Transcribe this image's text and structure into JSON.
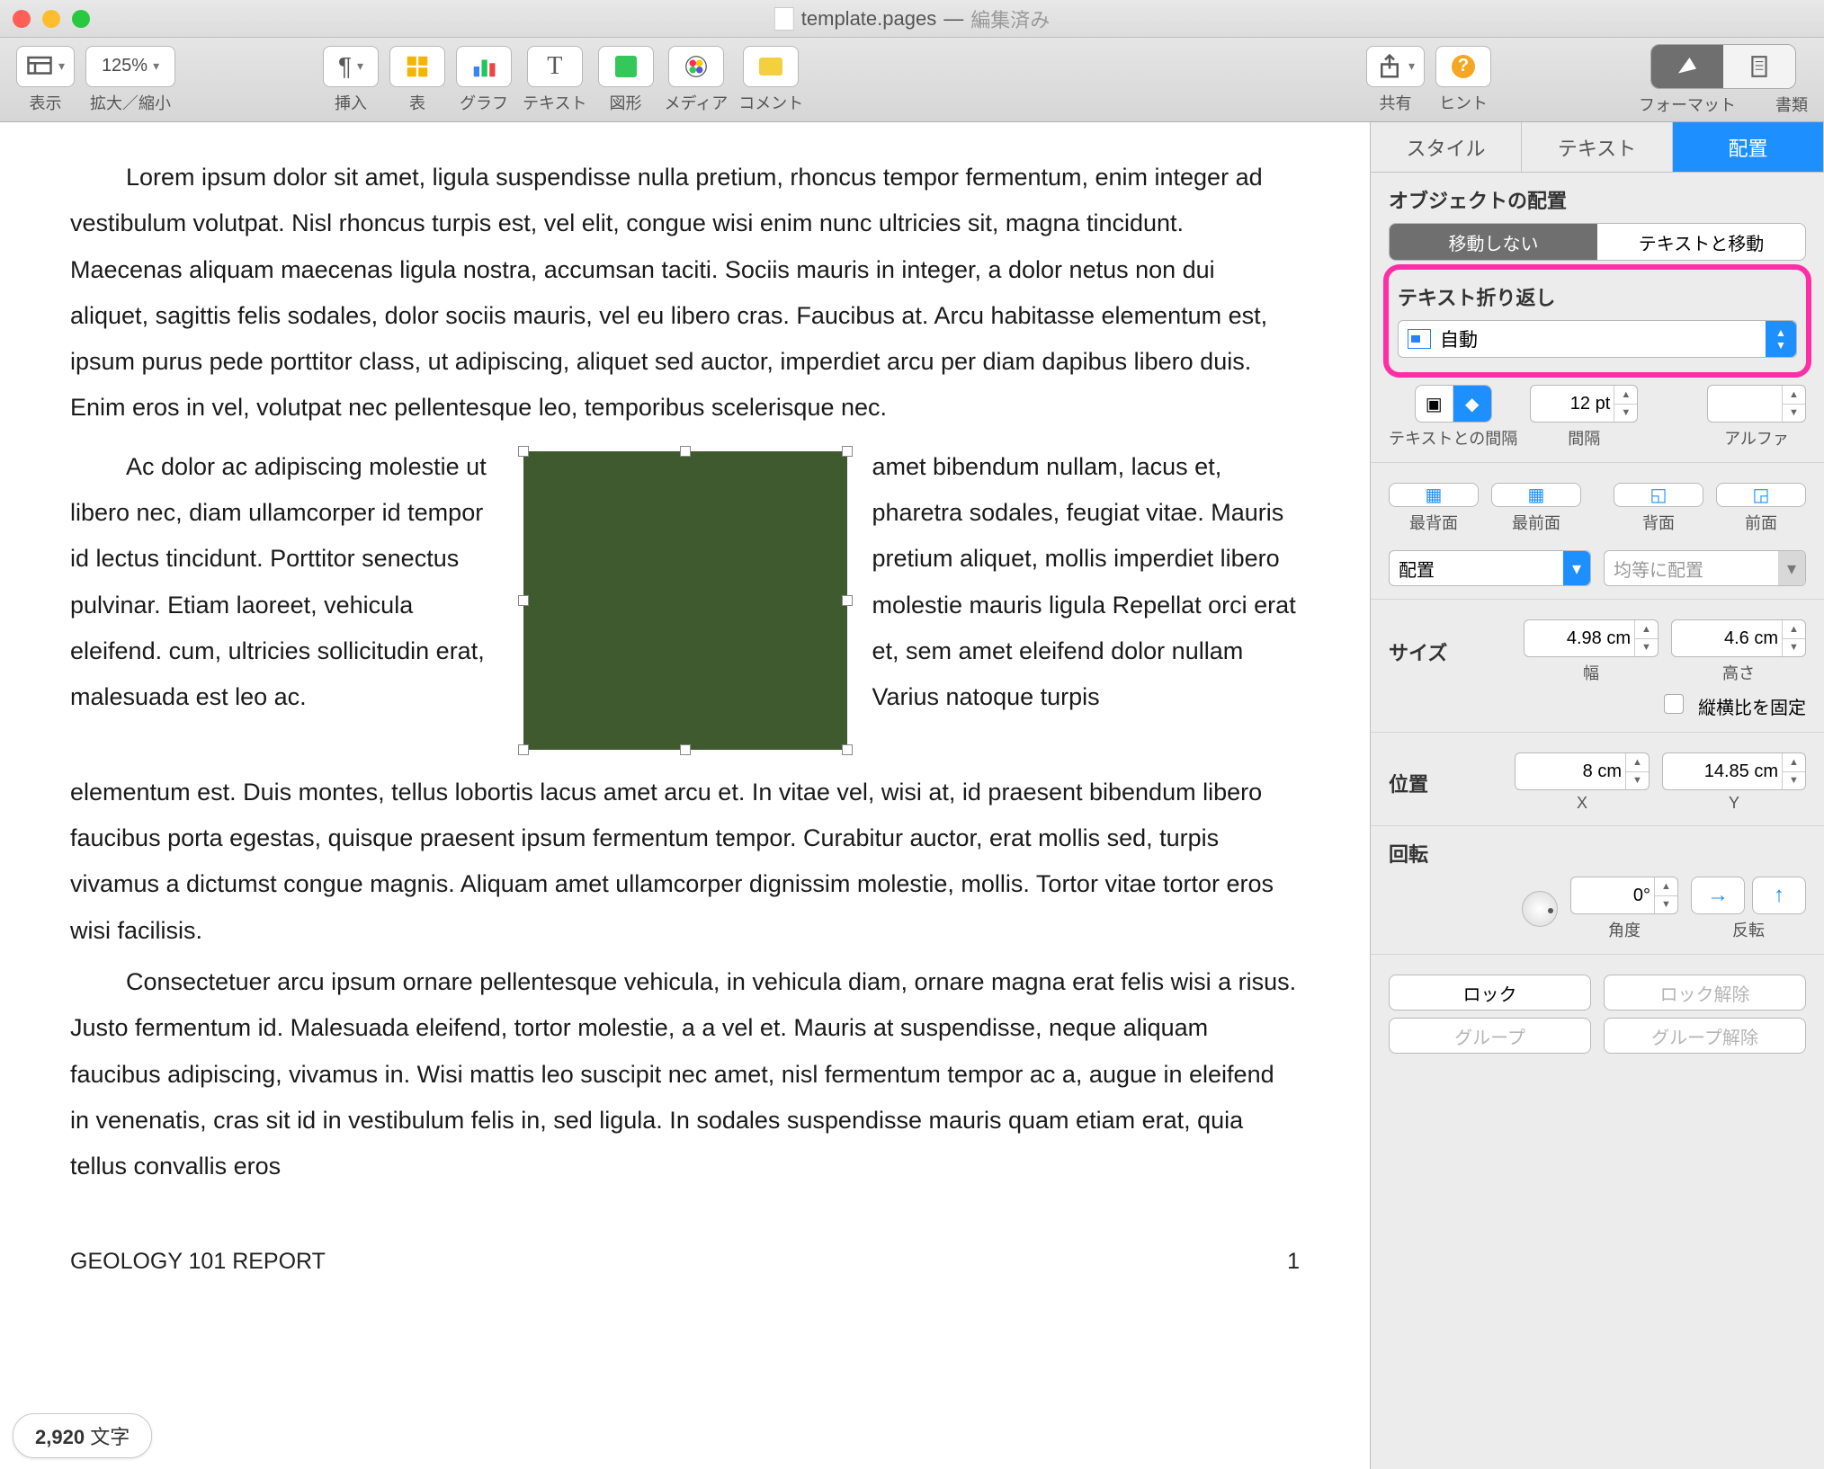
{
  "window": {
    "filename": "template.pages",
    "edited": "編集済み"
  },
  "toolbar": {
    "view": "表示",
    "zoom_value": "125%",
    "zoom_label": "拡大／縮小",
    "insert": "挿入",
    "table": "表",
    "chart": "グラフ",
    "text": "テキスト",
    "shape": "図形",
    "media": "メディア",
    "comment": "コメント",
    "share": "共有",
    "hint": "ヒント",
    "format": "フォーマット",
    "document": "書類"
  },
  "doc": {
    "para1": "Lorem ipsum dolor sit amet, ligula suspendisse nulla pretium, rhoncus tempor fermentum, enim integer ad vestibulum volutpat. Nisl rhoncus turpis est, vel elit, congue wisi enim nunc ultricies sit, magna tincidunt. Maecenas aliquam maecenas ligula nostra, accumsan taciti. Sociis mauris in integer, a dolor netus non dui aliquet, sagittis felis sodales, dolor sociis mauris, vel eu libero cras. Faucibus at. Arcu habitasse elementum est, ipsum purus pede porttitor class, ut adipiscing, aliquet sed auctor, imperdiet arcu per diam dapibus libero duis. Enim eros in vel, volutpat nec pellentesque leo, temporibus scelerisque nec.",
    "wrap_left": "Ac dolor ac adipiscing molestie ut libero nec, diam ullamcorper id tempor id lectus tincidunt. Porttitor senectus pulvinar. Etiam laoreet, vehicula eleifend. cum, ultricies sollicitudin erat, malesuada est leo ac.",
    "wrap_right": "amet bibendum nullam, lacus et, pharetra sodales, feugiat vitae. Mauris pretium aliquet, mollis imperdiet libero molestie mauris ligula Repellat orci erat et, sem amet eleifend dolor nullam Varius natoque turpis",
    "para2": "elementum est. Duis montes, tellus lobortis lacus amet arcu et. In vitae vel, wisi at, id praesent bibendum libero faucibus porta egestas, quisque praesent ipsum fermentum tempor. Curabitur auctor, erat mollis sed, turpis vivamus a dictumst congue magnis. Aliquam amet ullamcorper dignissim molestie, mollis. Tortor vitae tortor eros wisi facilisis.",
    "para3": "Consectetuer arcu ipsum ornare pellentesque vehicula, in vehicula diam, ornare magna erat felis wisi a risus. Justo fermentum id. Malesuada eleifend, tortor molestie, a a vel et. Mauris at suspendisse, neque aliquam faucibus adipiscing, vivamus in. Wisi mattis leo suscipit nec amet, nisl fermentum tempor ac a, augue in eleifend in venenatis, cras sit id in vestibulum felis in, sed ligula. In sodales suspendisse mauris quam etiam erat, quia tellus convallis eros",
    "footer_title": "GEOLOGY 101 REPORT",
    "page_num": "1",
    "wordcount_num": "2,920",
    "wordcount_unit": "文字"
  },
  "inspector": {
    "tab_style": "スタイル",
    "tab_text": "テキスト",
    "tab_arrange": "配置",
    "object_place_title": "オブジェクトの配置",
    "move_none": "移動しない",
    "move_text": "テキストと移動",
    "wrap_title": "テキスト折り返し",
    "wrap_value": "自動",
    "spacing_text_label": "テキストとの間隔",
    "spacing_label": "間隔",
    "spacing_value": "12 pt",
    "alpha_label": "アルファ",
    "back_most": "最背面",
    "front_most": "最前面",
    "back": "背面",
    "front": "前面",
    "align": "配置",
    "distribute": "均等に配置",
    "size_title": "サイズ",
    "width_value": "4.98 cm",
    "width_label": "幅",
    "height_value": "4.6 cm",
    "height_label": "高さ",
    "aspect": "縦横比を固定",
    "pos_title": "位置",
    "x_value": "8 cm",
    "x_label": "X",
    "y_value": "14.85 cm",
    "y_label": "Y",
    "rotate_title": "回転",
    "angle_value": "0°",
    "angle_label": "角度",
    "flip_label": "反転",
    "lock": "ロック",
    "unlock": "ロック解除",
    "group": "グループ",
    "ungroup": "グループ解除"
  }
}
